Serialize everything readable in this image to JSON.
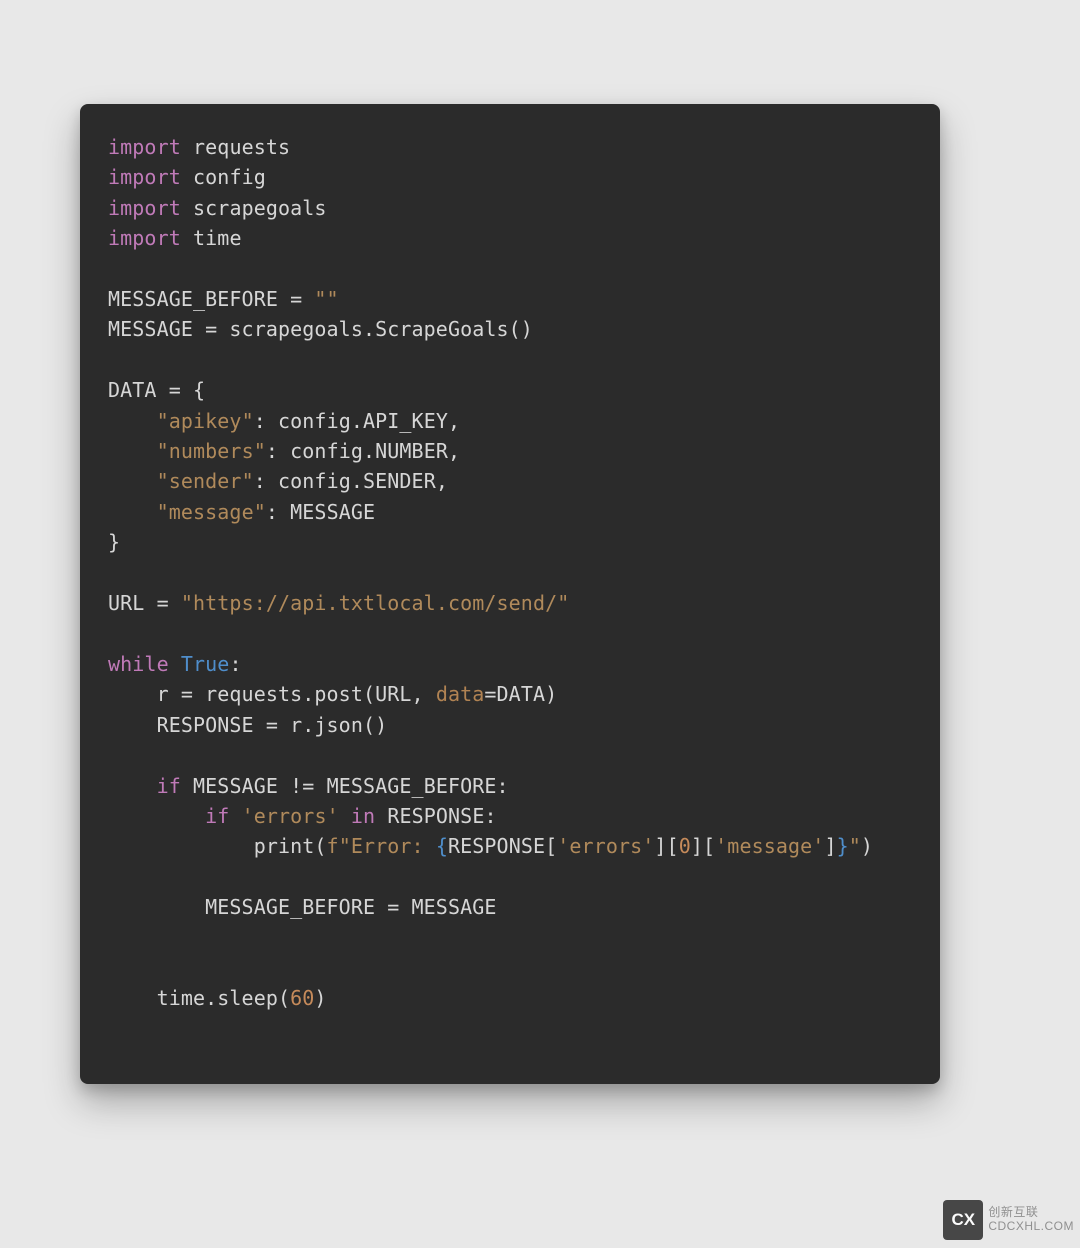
{
  "code": {
    "tokens": [
      [
        [
          "kw",
          "import"
        ],
        [
          "punc",
          " "
        ],
        [
          "mod",
          "requests"
        ]
      ],
      [
        [
          "kw",
          "import"
        ],
        [
          "punc",
          " "
        ],
        [
          "mod",
          "config"
        ]
      ],
      [
        [
          "kw",
          "import"
        ],
        [
          "punc",
          " "
        ],
        [
          "mod",
          "scrapegoals"
        ]
      ],
      [
        [
          "kw",
          "import"
        ],
        [
          "punc",
          " "
        ],
        [
          "mod",
          "time"
        ]
      ],
      [],
      [
        [
          "mod",
          "MESSAGE_BEFORE = "
        ],
        [
          "str",
          "\"\""
        ]
      ],
      [
        [
          "mod",
          "MESSAGE = scrapegoals.ScrapeGoals()"
        ]
      ],
      [],
      [
        [
          "mod",
          "DATA = {"
        ]
      ],
      [
        [
          "mod",
          "    "
        ],
        [
          "str",
          "\"apikey\""
        ],
        [
          "mod",
          ": config.API_KEY,"
        ]
      ],
      [
        [
          "mod",
          "    "
        ],
        [
          "str",
          "\"numbers\""
        ],
        [
          "mod",
          ": config.NUMBER,"
        ]
      ],
      [
        [
          "mod",
          "    "
        ],
        [
          "str",
          "\"sender\""
        ],
        [
          "mod",
          ": config.SENDER,"
        ]
      ],
      [
        [
          "mod",
          "    "
        ],
        [
          "str",
          "\"message\""
        ],
        [
          "mod",
          ": MESSAGE"
        ]
      ],
      [
        [
          "mod",
          "}"
        ]
      ],
      [],
      [
        [
          "mod",
          "URL = "
        ],
        [
          "str",
          "\"https://api.txtlocal.com/send/\""
        ]
      ],
      [],
      [
        [
          "kw",
          "while"
        ],
        [
          "punc",
          " "
        ],
        [
          "true",
          "True"
        ],
        [
          "mod",
          ":"
        ]
      ],
      [
        [
          "mod",
          "    r = requests.post(URL, "
        ],
        [
          "param",
          "data"
        ],
        [
          "mod",
          "=DATA)"
        ]
      ],
      [
        [
          "mod",
          "    RESPONSE = r.json()"
        ]
      ],
      [],
      [
        [
          "mod",
          "    "
        ],
        [
          "kw",
          "if"
        ],
        [
          "mod",
          " MESSAGE != MESSAGE_BEFORE:"
        ]
      ],
      [
        [
          "mod",
          "        "
        ],
        [
          "kw",
          "if"
        ],
        [
          "mod",
          " "
        ],
        [
          "str",
          "'errors'"
        ],
        [
          "mod",
          " "
        ],
        [
          "kw",
          "in"
        ],
        [
          "mod",
          " RESPONSE:"
        ]
      ],
      [
        [
          "mod",
          "            print("
        ],
        [
          "str",
          "f\"Error: "
        ],
        [
          "true",
          "{"
        ],
        [
          "mod",
          "RESPONSE["
        ],
        [
          "str",
          "'errors'"
        ],
        [
          "mod",
          "]["
        ],
        [
          "num",
          "0"
        ],
        [
          "mod",
          "]["
        ],
        [
          "str",
          "'message'"
        ],
        [
          "mod",
          "]"
        ],
        [
          "true",
          "}"
        ],
        [
          "str",
          "\""
        ],
        [
          "mod",
          ")"
        ]
      ],
      [],
      [
        [
          "mod",
          "        MESSAGE_BEFORE = MESSAGE"
        ]
      ],
      [],
      [],
      [
        [
          "mod",
          "    time.sleep("
        ],
        [
          "num",
          "60"
        ],
        [
          "mod",
          ")"
        ]
      ]
    ]
  },
  "watermark": {
    "logo_text": "CX",
    "line1": "创新互联",
    "line2": "CDCXHL.COM"
  }
}
